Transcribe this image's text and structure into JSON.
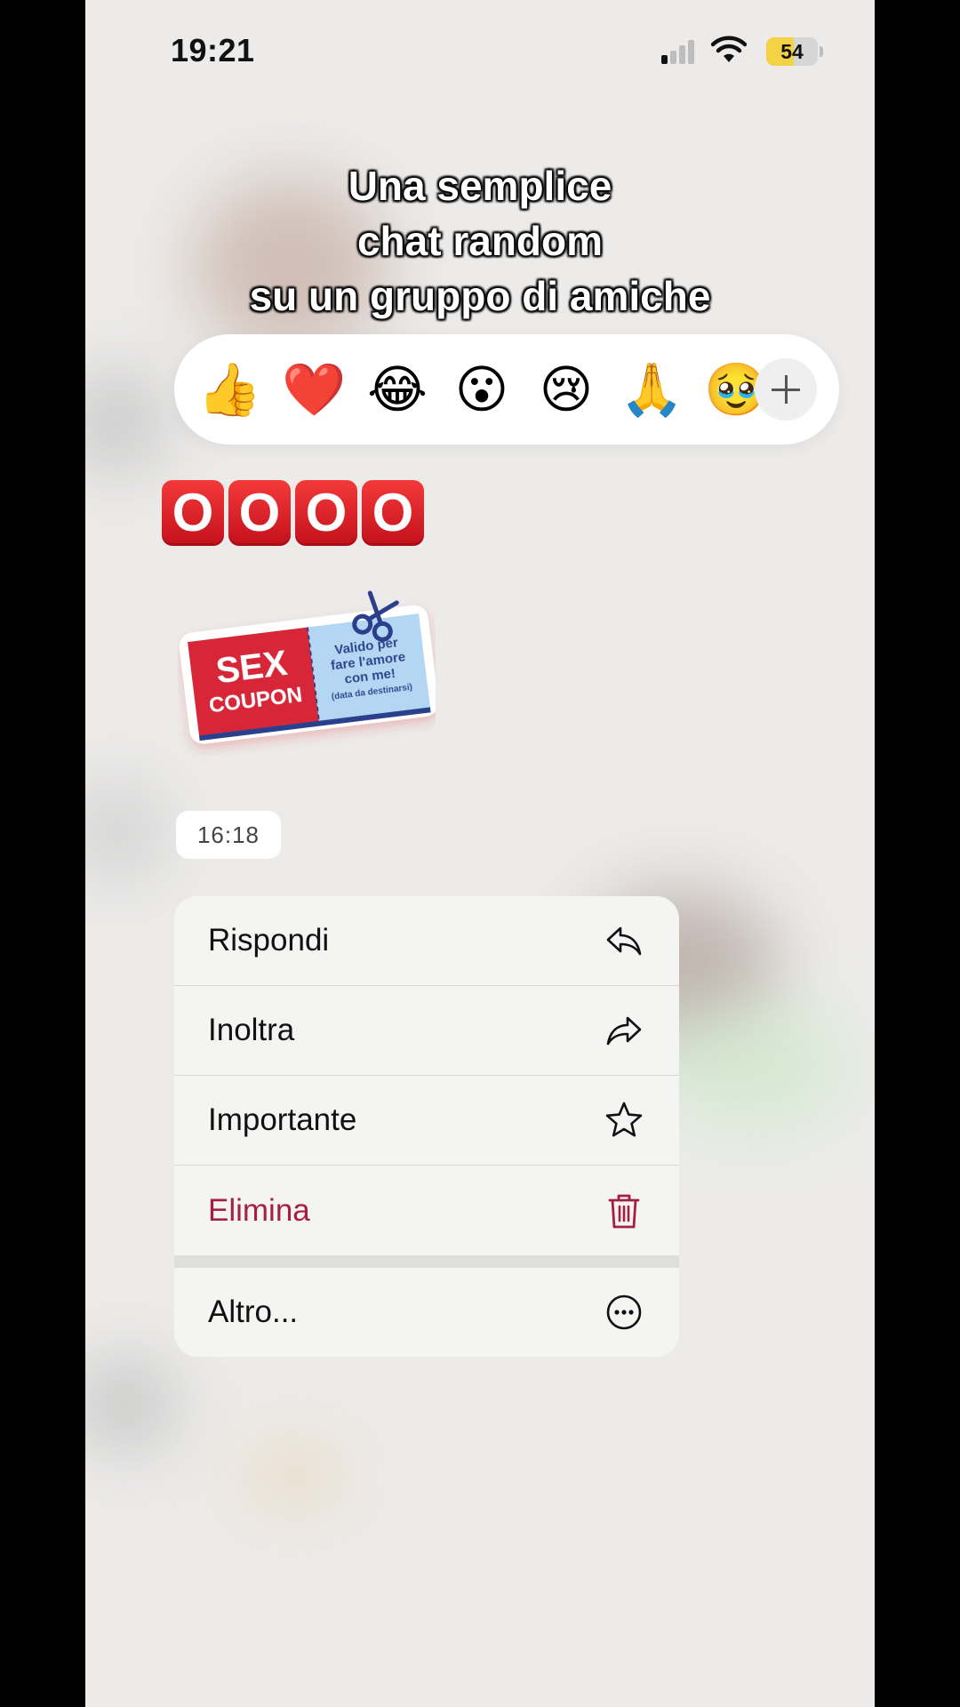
{
  "status_bar": {
    "time": "19:21",
    "battery": "54",
    "battery_level": 0.54
  },
  "caption": {
    "line1": "Una semplice",
    "line2": "chat random",
    "line3": "su un gruppo di amiche"
  },
  "reactions": [
    "👍",
    "❤️",
    "😂",
    "😮",
    "😢",
    "🙏",
    "🥹"
  ],
  "message": {
    "emoji_letters": [
      "O",
      "O",
      "O",
      "O"
    ],
    "sticker": {
      "left_line1": "SEX",
      "left_line2": "COUPON",
      "right_line1": "Valido per",
      "right_line2": "fare l'amore",
      "right_line3": "con me!",
      "right_line4": "(data da destinarsi)"
    },
    "timestamp": "16:18"
  },
  "menu": {
    "items": [
      {
        "label": "Rispondi",
        "icon": "reply-icon"
      },
      {
        "label": "Inoltra",
        "icon": "forward-icon"
      },
      {
        "label": "Importante",
        "icon": "star-icon"
      },
      {
        "label": "Elimina",
        "icon": "trash-icon"
      }
    ],
    "more": {
      "label": "Altro...",
      "icon": "more-icon"
    }
  },
  "colors": {
    "danger": "#a51f45",
    "battery": "#f3d343",
    "background": "#ecebea"
  }
}
